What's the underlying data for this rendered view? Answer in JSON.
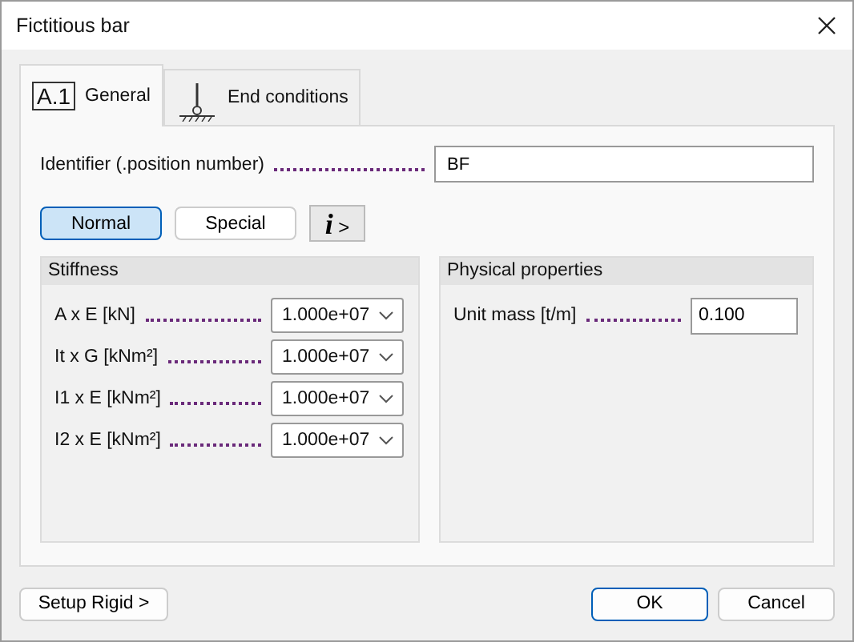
{
  "window": {
    "title": "Fictitious bar"
  },
  "tabs": [
    {
      "badge": "A.1",
      "label": "General",
      "kind": "badge",
      "selected": true
    },
    {
      "label": "End conditions",
      "kind": "support",
      "selected": false
    }
  ],
  "identifier": {
    "label": "Identifier (.position number)",
    "value": "BF"
  },
  "modes": [
    {
      "label": "Normal",
      "selected": true
    },
    {
      "label": "Special",
      "selected": false
    }
  ],
  "info_button": {
    "glyph": "i",
    "arrow": ">"
  },
  "stiffness": {
    "title": "Stiffness",
    "rows": [
      {
        "label": "A x E [kN]",
        "value": "1.000e+07"
      },
      {
        "label": "It x G [kNm²]",
        "value": "1.000e+07"
      },
      {
        "label": "I1 x E [kNm²]",
        "value": "1.000e+07"
      },
      {
        "label": "I2 x E [kNm²]",
        "value": "1.000e+07"
      }
    ]
  },
  "physical": {
    "title": "Physical properties",
    "rows": [
      {
        "label": "Unit mass [t/m]",
        "value": "0.100"
      }
    ]
  },
  "buttons": {
    "setup": "Setup Rigid >",
    "ok": "OK",
    "cancel": "Cancel"
  }
}
